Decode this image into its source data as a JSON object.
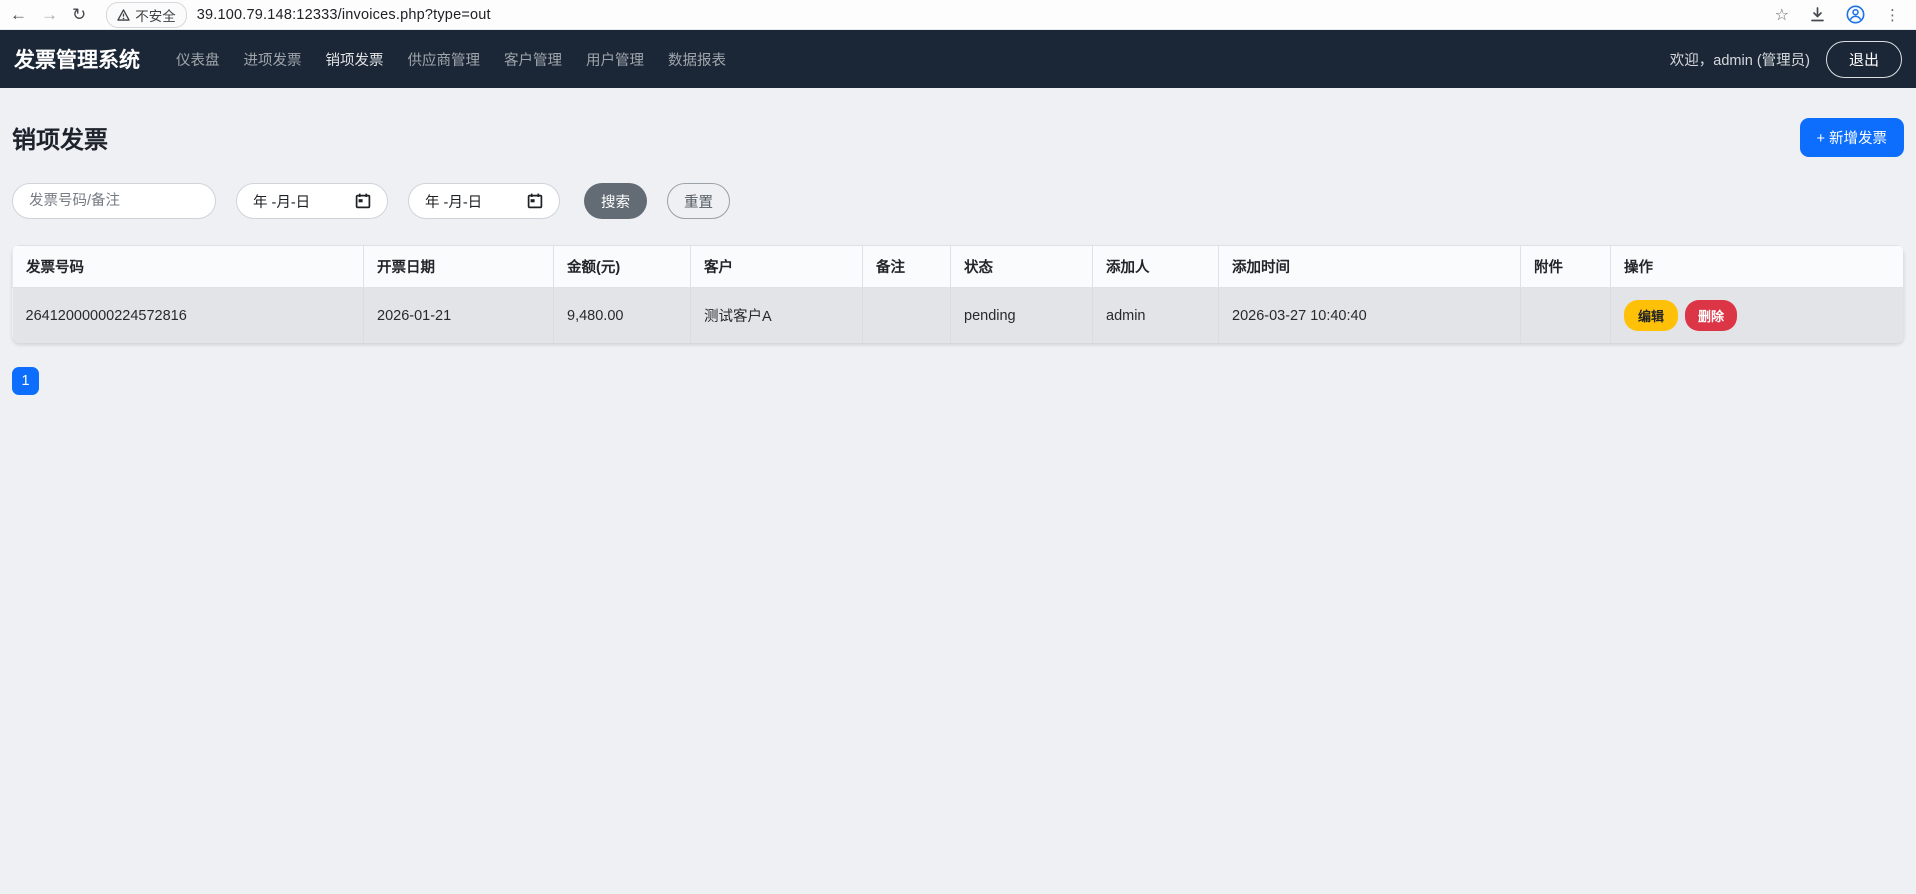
{
  "browser": {
    "security_chip": "不安全",
    "url": "39.100.79.148:12333/invoices.php?type=out"
  },
  "navbar": {
    "brand": "发票管理系统",
    "items": [
      {
        "label": "仪表盘"
      },
      {
        "label": "进项发票"
      },
      {
        "label": "销项发票"
      },
      {
        "label": "供应商管理"
      },
      {
        "label": "客户管理"
      },
      {
        "label": "用户管理"
      },
      {
        "label": "数据报表"
      }
    ],
    "welcome": "欢迎，admin (管理员)",
    "logout_label": "退出"
  },
  "page": {
    "title": "销项发票",
    "add_button": "+ 新增发票"
  },
  "filters": {
    "keyword_placeholder": "发票号码/备注",
    "date_from_value": "年 -月-日",
    "date_to_value": "年 -月-日",
    "search_label": "搜索",
    "reset_label": "重置"
  },
  "table": {
    "headers": [
      "发票号码",
      "开票日期",
      "金额(元)",
      "客户",
      "备注",
      "状态",
      "添加人",
      "添加时间",
      "附件",
      "操作"
    ],
    "actions": {
      "edit": "编辑",
      "delete": "删除"
    },
    "rows": [
      {
        "invoice_no": "26412000000224572816",
        "invoice_date": "2026-01-21",
        "amount": "9,480.00",
        "customer": "测试客户A",
        "remark": "",
        "status": "pending",
        "added_by": "admin",
        "added_time": "2026-03-27 10:40:40",
        "attachment": ""
      }
    ]
  },
  "pagination": {
    "pages": [
      "1"
    ]
  },
  "colors": {
    "primary": "#0d6efd",
    "warning": "#ffc107",
    "danger": "#dc3545",
    "navbar": "#1b2636",
    "secondary": "#636b74",
    "pagebg": "#eef0f4"
  }
}
